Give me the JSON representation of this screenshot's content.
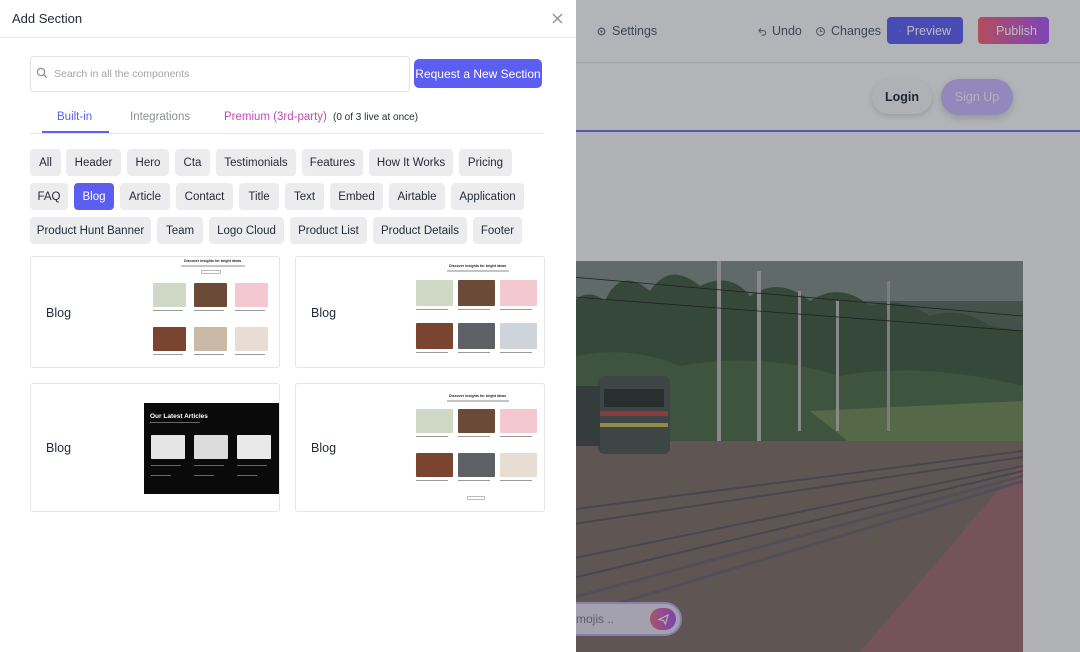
{
  "editor": {
    "toolbar": {
      "settings_label": "Settings",
      "undo_label": "Undo",
      "changes_label": "Changes",
      "preview_label": "Preview",
      "publish_label": "Publish"
    },
    "nav": {
      "login_label": "Login",
      "signup_label": "Sign Up"
    },
    "chat": {
      "placeholder_fragment": "mojis .."
    },
    "colors": {
      "accent": "#5b5ef0",
      "publish_gradient_start": "#f06273",
      "publish_gradient_end": "#a855f7"
    }
  },
  "modal": {
    "title": "Add Section",
    "search": {
      "placeholder": "Search in all the components",
      "value": ""
    },
    "request_button_label": "Request a New Section",
    "tabs": {
      "builtin": "Built-in",
      "integrations": "Integrations",
      "premium": "Premium (3rd-party)",
      "premium_note": "(0 of 3 live at once)"
    },
    "categories": [
      "All",
      "Header",
      "Hero",
      "Cta",
      "Testimonials",
      "Features",
      "How It Works",
      "Pricing",
      "FAQ",
      "Blog",
      "Article",
      "Contact",
      "Title",
      "Text",
      "Embed",
      "Airtable",
      "Application",
      "Product Hunt Banner",
      "Team",
      "Logo Cloud",
      "Product List",
      "Product Details",
      "Footer"
    ],
    "selected_category": "Blog",
    "cards": [
      {
        "label": "Blog",
        "preview_title": "Discover insights for bright ideas"
      },
      {
        "label": "Blog",
        "preview_title": "Discover insights for bright ideas"
      },
      {
        "label": "Blog",
        "preview_title": "Our Latest Articles"
      },
      {
        "label": "Blog",
        "preview_title": "Discover insights for bright ideas"
      }
    ]
  }
}
